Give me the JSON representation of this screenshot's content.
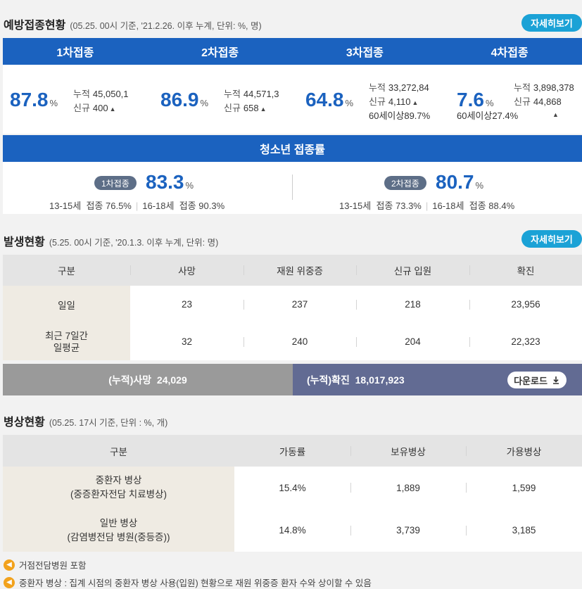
{
  "vaccination": {
    "title": "예방접종현황",
    "note": "(05.25. 00시 기준, '21.2.26. 이후 누계, 단위: %, 명)",
    "detail_label": "자세히보기",
    "doses": [
      {
        "label": "1차접종",
        "pct": "87.8",
        "unit": "%",
        "cum_label": "누적",
        "cum": "45,050,1",
        "new_label": "신규",
        "new": "400"
      },
      {
        "label": "2차접종",
        "pct": "86.9",
        "unit": "%",
        "cum_label": "누적",
        "cum": "44,571,3",
        "new_label": "신규",
        "new": "658"
      },
      {
        "label": "3차접종",
        "pct": "64.8",
        "unit": "%",
        "cum_label": "누적",
        "cum": "33,272,84",
        "new_label": "신규",
        "new": "4,110",
        "sixty_label": "60세이상",
        "sixty": "89.7%"
      },
      {
        "label": "4차접종",
        "pct": "7.6",
        "unit": "%",
        "cum_label": "누적",
        "cum": "3,898,378",
        "new_label": "신규",
        "new": "44,868",
        "sixty_label": "60세이상",
        "sixty": "27.4%"
      }
    ],
    "youth": {
      "title": "청소년 접종률",
      "first": {
        "pill": "1차접종",
        "pct": "83.3",
        "unit": "%",
        "a_label": "13-15세",
        "a_kind": "접종",
        "a_val": "76.5%",
        "b_label": "16-18세",
        "b_kind": "접종",
        "b_val": "90.3%"
      },
      "second": {
        "pill": "2차접종",
        "pct": "80.7",
        "unit": "%",
        "a_label": "13-15세",
        "a_kind": "접종",
        "a_val": "73.3%",
        "b_label": "16-18세",
        "b_kind": "접종",
        "b_val": "88.4%"
      }
    }
  },
  "occurrence": {
    "title": "발생현황",
    "note": "(5.25. 00시 기준, '20.1.3. 이후 누계, 단위: 명)",
    "detail_label": "자세히보기",
    "headers": [
      "구분",
      "사망",
      "재원 위중증",
      "신규 입원",
      "확진"
    ],
    "rows": [
      {
        "label": "일일",
        "values": [
          "23",
          "237",
          "218",
          "23,956"
        ]
      },
      {
        "label": "최근 7일간\n일평균",
        "values": [
          "32",
          "240",
          "204",
          "22,323"
        ]
      }
    ],
    "cum_death_label": "(누적)사망",
    "cum_death": "24,029",
    "cum_confirmed_label": "(누적)확진",
    "cum_confirmed": "18,017,923",
    "download_label": "다운로드"
  },
  "beds": {
    "title": "병상현황",
    "note": "(05.25. 17시 기준, 단위 : %, 개)",
    "headers": [
      "구분",
      "가동률",
      "보유병상",
      "가용병상"
    ],
    "rows": [
      {
        "label": "중환자 병상\n(중증환자전담 치료병상)",
        "values": [
          "15.4%",
          "1,889",
          "1,599"
        ]
      },
      {
        "label": "일반 병상\n(감염병전담 병원(중등증))",
        "values": [
          "14.8%",
          "3,739",
          "3,185"
        ]
      }
    ]
  },
  "footnotes": [
    "거점전담병원 포함",
    "중환자 병상 : 집계 시점의 중환자 병상 사용(입원) 현황으로 재원 위중증 환자 수와 상이할 수 있음"
  ]
}
